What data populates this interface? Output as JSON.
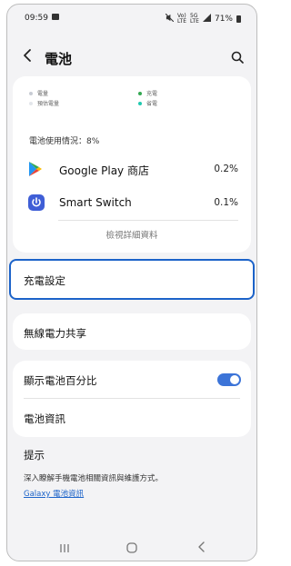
{
  "status_bar": {
    "time": "09:59",
    "battery": "71%",
    "volte_label": "Vo)\nLTE",
    "network_label": "5G\nLTE"
  },
  "app_bar": {
    "title": "電池",
    "icons": [
      "back-arrow-icon",
      "search-icon"
    ]
  },
  "legend": {
    "items": [
      {
        "label": "電量",
        "color": "#c8ccd4"
      },
      {
        "label": "預估電量",
        "color": "#e3e6eb"
      },
      {
        "label": "充電",
        "color": "#34a853"
      },
      {
        "label": "省電",
        "color": "#21c9b0"
      }
    ]
  },
  "usage": {
    "label": "電池使用情況：8%",
    "apps": [
      {
        "name": "Google Play 商店",
        "percent": "0.2%",
        "icon": "google-play-icon"
      },
      {
        "name": "Smart Switch",
        "percent": "0.1%",
        "icon": "smart-switch-icon"
      }
    ],
    "details_link": "檢視詳細資料"
  },
  "menu": {
    "charging_settings": "充電設定",
    "wireless_power_share": "無線電力共享",
    "show_battery_percent": "顯示電池百分比",
    "show_battery_percent_on": true,
    "battery_info": "電池資訊"
  },
  "tips": {
    "title": "提示",
    "text": "深入瞭解手機電池相關資訊與維護方式。",
    "link": "Galaxy 電池資訊"
  },
  "nav_bar": {
    "icons": [
      "recent-apps-icon",
      "home-icon",
      "back-icon"
    ]
  },
  "colors": {
    "accent": "#1c63c9",
    "toggle": "#3c74d8",
    "background": "#f3f3f5"
  }
}
